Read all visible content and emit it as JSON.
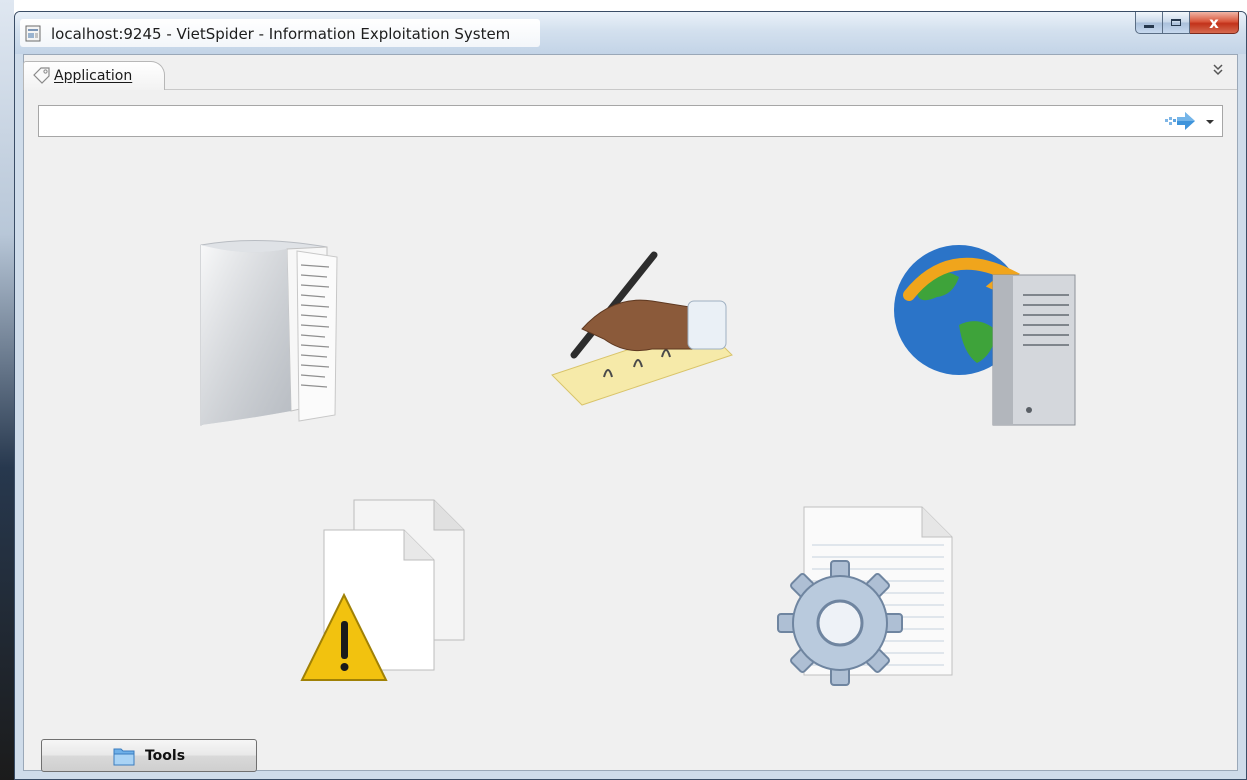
{
  "window": {
    "title": "localhost:9245 - VietSpider - Information Exploitation System",
    "close_glyph": "x"
  },
  "tabs": [
    {
      "label": "Application",
      "icon": "tag-icon",
      "selected": true
    }
  ],
  "address_bar": {
    "value": "",
    "go_icon": "go-arrow-icon",
    "dropdown_icon": "chevron-down-icon"
  },
  "launcher_icons": [
    {
      "icon": "document-folder-icon"
    },
    {
      "icon": "signing-hand-icon"
    },
    {
      "icon": "globe-server-icon"
    },
    {
      "icon": "documents-warning-icon"
    },
    {
      "icon": "settings-file-icon"
    }
  ],
  "tools_button": {
    "label": "Tools",
    "icon": "blue-folder-icon"
  },
  "colors": {
    "titlebar": "#d3e0ee",
    "close_button": "#c2321a",
    "content_bg": "#f0f0f0"
  }
}
